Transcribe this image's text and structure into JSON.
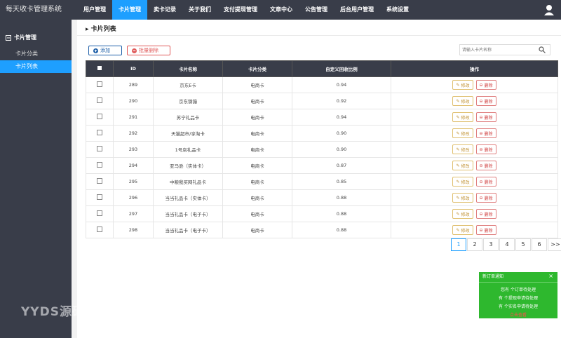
{
  "app": {
    "title": "每天收卡管理系统"
  },
  "nav": [
    {
      "label": "用户管理",
      "active": false
    },
    {
      "label": "卡片管理",
      "active": true
    },
    {
      "label": "卖卡记录",
      "active": false
    },
    {
      "label": "关于我们",
      "active": false
    },
    {
      "label": "支付提现管理",
      "active": false
    },
    {
      "label": "文章中心",
      "active": false
    },
    {
      "label": "公告管理",
      "active": false
    },
    {
      "label": "后台用户管理",
      "active": false
    },
    {
      "label": "系统设置",
      "active": false
    }
  ],
  "sidebar": {
    "group_label": "卡片管理",
    "items": [
      {
        "label": "卡片分类",
        "active": false
      },
      {
        "label": "卡片列表",
        "active": true
      }
    ]
  },
  "page": {
    "title": "卡片列表"
  },
  "toolbar": {
    "add_label": "添加",
    "batch_delete_label": "批量删除",
    "search_placeholder": "请输入卡片名称"
  },
  "table": {
    "headers": [
      "ID",
      "卡片名称",
      "卡片分类",
      "自定义回收比例",
      "操作"
    ],
    "edit_label": "修改",
    "delete_label": "删除",
    "rows": [
      {
        "id": "289",
        "name": "京东E卡",
        "category": "电商卡",
        "rate": "0.94"
      },
      {
        "id": "290",
        "name": "京东钢镚",
        "category": "电商卡",
        "rate": "0.92"
      },
      {
        "id": "291",
        "name": "苏宁礼品卡",
        "category": "电商卡",
        "rate": "0.94"
      },
      {
        "id": "292",
        "name": "天猫超市/享淘卡",
        "category": "电商卡",
        "rate": "0.90"
      },
      {
        "id": "293",
        "name": "1号店礼品卡",
        "category": "电商卡",
        "rate": "0.90"
      },
      {
        "id": "294",
        "name": "亚马逊（实体卡）",
        "category": "电商卡",
        "rate": "0.87"
      },
      {
        "id": "295",
        "name": "中粮我买网礼品卡",
        "category": "电商卡",
        "rate": "0.85"
      },
      {
        "id": "296",
        "name": "当当礼品卡（实体卡）",
        "category": "电商卡",
        "rate": "0.88"
      },
      {
        "id": "297",
        "name": "当当礼品卡（电子卡）",
        "category": "电商卡",
        "rate": "0.88"
      },
      {
        "id": "298",
        "name": "当当礼品卡（电子卡）",
        "category": "电商卡",
        "rate": "0.88"
      }
    ]
  },
  "pagination": {
    "pages": [
      "1",
      "2",
      "3",
      "4",
      "5",
      "6",
      ">>"
    ],
    "current": "1"
  },
  "notice": {
    "title": "新订单通知",
    "lines": [
      "您有 个订单待处理",
      "有 个提现申请待处理",
      "有 个实名申请待处理"
    ],
    "link": "点击查看"
  },
  "watermark": "YYDS源码网",
  "colors": {
    "topbar": "#393d49",
    "accent": "#1e9fff",
    "notice": "#2eb82e"
  }
}
